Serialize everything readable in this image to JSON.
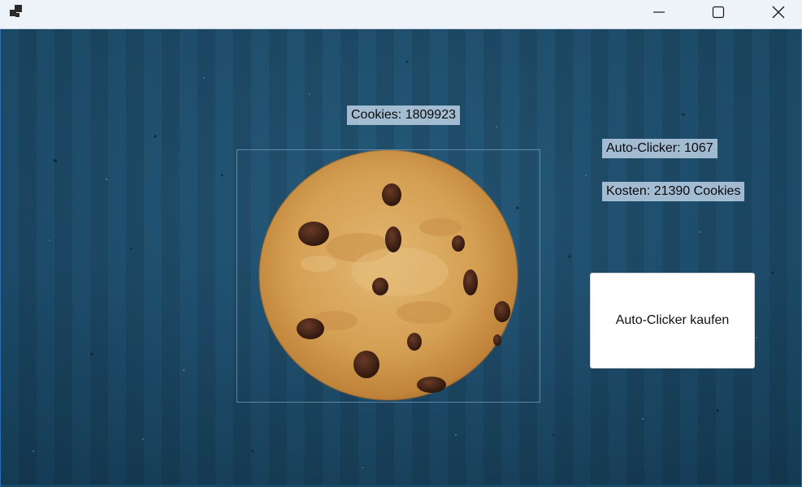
{
  "window": {
    "icons": {
      "app": "app-window-icon",
      "minimize": "minimize-icon",
      "maximize": "maximize-icon",
      "close": "close-icon"
    }
  },
  "game": {
    "cookies_label": "Cookies: 1809923",
    "autoclicker_label": "Auto-Clicker: 1067",
    "cost_label": "Kosten: 21390 Cookies",
    "buy_button_label": "Auto-Clicker kaufen"
  },
  "colors": {
    "background": "#1d4f70",
    "label_bg": "#c0d4e8",
    "button_bg": "#ffffff",
    "cookie_dough": "#d9a45a"
  }
}
